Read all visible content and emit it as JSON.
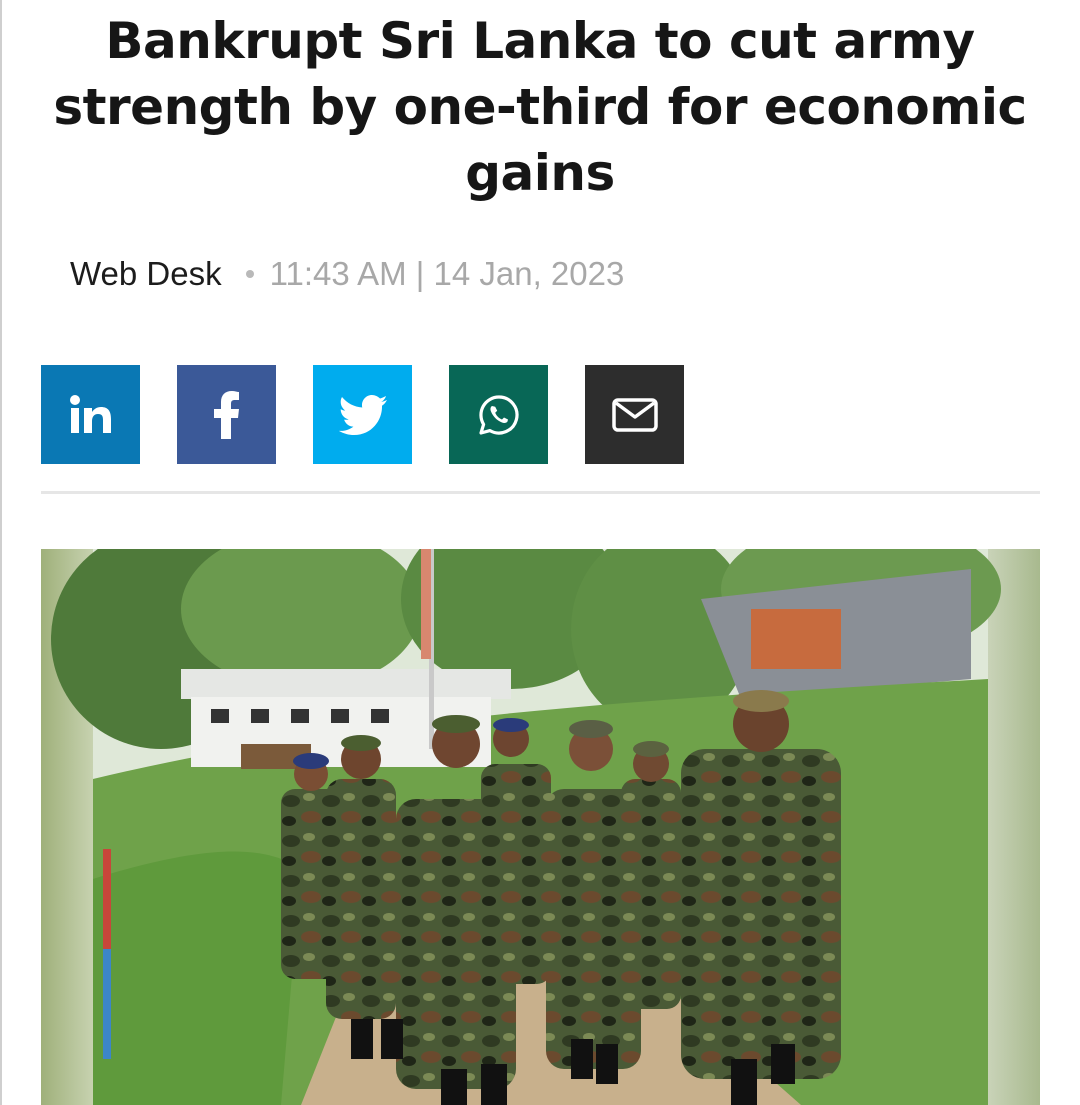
{
  "article": {
    "headline": "Bankrupt Sri Lanka to cut army strength by one-third for economic gains",
    "author": "Web Desk",
    "datetime": "11:43 AM | 14 Jan, 2023"
  },
  "share": {
    "buttons": [
      {
        "name": "linkedin",
        "icon": "linkedin-icon",
        "color": "#0a78b4"
      },
      {
        "name": "facebook",
        "icon": "facebook-icon",
        "color": "#3b5998"
      },
      {
        "name": "twitter",
        "icon": "twitter-icon",
        "color": "#00acee"
      },
      {
        "name": "whatsapp",
        "icon": "whatsapp-icon",
        "color": "#086756"
      },
      {
        "name": "email",
        "icon": "envelope-icon",
        "color": "#2d2d2d"
      }
    ]
  },
  "featured_image": {
    "description_icon": "photo-soldiers-walking"
  }
}
